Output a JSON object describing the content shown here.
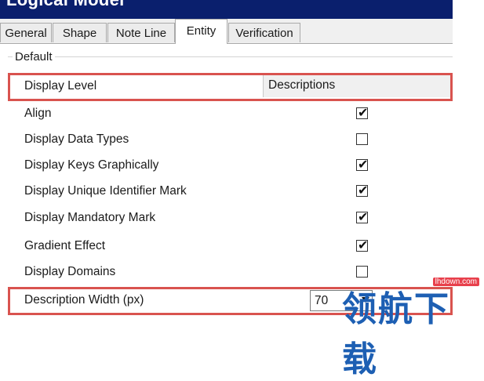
{
  "window": {
    "title": "Logical Model"
  },
  "tabs": [
    {
      "label": "General"
    },
    {
      "label": "Shape"
    },
    {
      "label": "Note Line"
    },
    {
      "label": "Entity",
      "active": true
    },
    {
      "label": "Verification"
    }
  ],
  "group": {
    "label": "Default"
  },
  "rows": {
    "display_level": {
      "label": "Display Level",
      "value": "Descriptions"
    },
    "align": {
      "label": "Align",
      "checked": true
    },
    "display_data_types": {
      "label": "Display Data Types",
      "checked": false
    },
    "display_keys_graphically": {
      "label": "Display Keys Graphically",
      "checked": true
    },
    "display_unique_identifier_mark": {
      "label": "Display Unique Identifier Mark",
      "checked": true
    },
    "display_mandatory_mark": {
      "label": "Display Mandatory Mark",
      "checked": true
    },
    "gradient_effect": {
      "label": "Gradient Effect",
      "checked": true
    },
    "display_domains": {
      "label": "Display Domains",
      "checked": false
    },
    "description_width": {
      "label": "Description Width (px)",
      "value": "70"
    }
  },
  "watermark": {
    "text": "领航下载",
    "url": "lhdown.com"
  },
  "colors": {
    "titlebar": "#0a1f6d",
    "highlight": "#d9534f",
    "watermark": "#1d5fb3"
  }
}
